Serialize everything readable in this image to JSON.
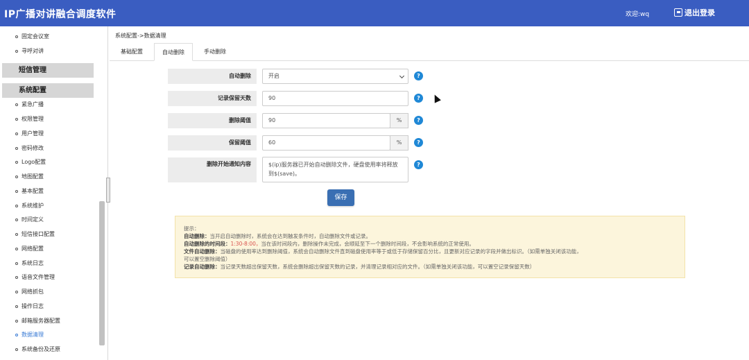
{
  "header": {
    "app_title": "IP广播对讲融合调度软件",
    "welcome": "欢迎:wq",
    "logout_label": "退出登录",
    "color": "#3a5dc1"
  },
  "sidebar": {
    "top_items": [
      "固定会议室",
      "寻呼对讲"
    ],
    "sections": [
      "短信管理",
      "系统配置"
    ],
    "config_items": [
      "紧急广播",
      "权限管理",
      "用户管理",
      "密码修改",
      "Logo配置",
      "地图配置",
      "基本配置",
      "系统维护",
      "时间定义",
      "短信接口配置",
      "网络配置",
      "系统日志",
      "语音文件管理",
      "网络抓包",
      "操作日志",
      "邮箱服务器配置",
      "数据清理",
      "系统备份及还原"
    ],
    "active_item": "数据清理"
  },
  "breadcrumb": "系统配置->数据清理",
  "tabs": [
    "基础配置",
    "自动删除",
    "手动删除"
  ],
  "active_tab": "自动删除",
  "form": {
    "auto_delete": {
      "label": "自动删除",
      "value": "开启"
    },
    "retain_days": {
      "label": "记录保留天数",
      "value": "90"
    },
    "delete_threshold": {
      "label": "删除阈值",
      "value": "90",
      "unit": "%"
    },
    "retain_threshold": {
      "label": "保留阈值",
      "value": "60",
      "unit": "%"
    },
    "notify_content": {
      "label": "删除开始通知内容",
      "value": "$(ip)服务器已开始自动删除文件，硬盘使用率将释放到$(save)。"
    },
    "help_icon": "?"
  },
  "save_label": "保存",
  "notice": {
    "title": "提示：",
    "line1_label": "自动删除：",
    "line1": "当开启自动删除时，系统会在达到触发条件时，自动删除文件或记录。",
    "line2_label": "自动删除的时间段：",
    "line2_time": "1:30-8:00，",
    "line2": "当在该时间段内，删除操作未完成，会顺延至下一个删除时间段，不会影响系统的正常使用。",
    "line3_label": "文件自动删除：",
    "line3": "当磁盘的使用率达到删除阈值，系统会自动删除文件直到磁盘使用率等于或低于存储保留百分比，且更新对应记录的字段并做出标识。（如需单独关闭该功能，",
    "line3b": "可以置空删除阈值）",
    "line4_label": "记录自动删除：",
    "line4": "当记录天数超出保留天数，系统会删除超出保留天数的记录，并清理记录相对应的文件。（如需单独关闭该功能，可以置空记录保留天数）"
  }
}
